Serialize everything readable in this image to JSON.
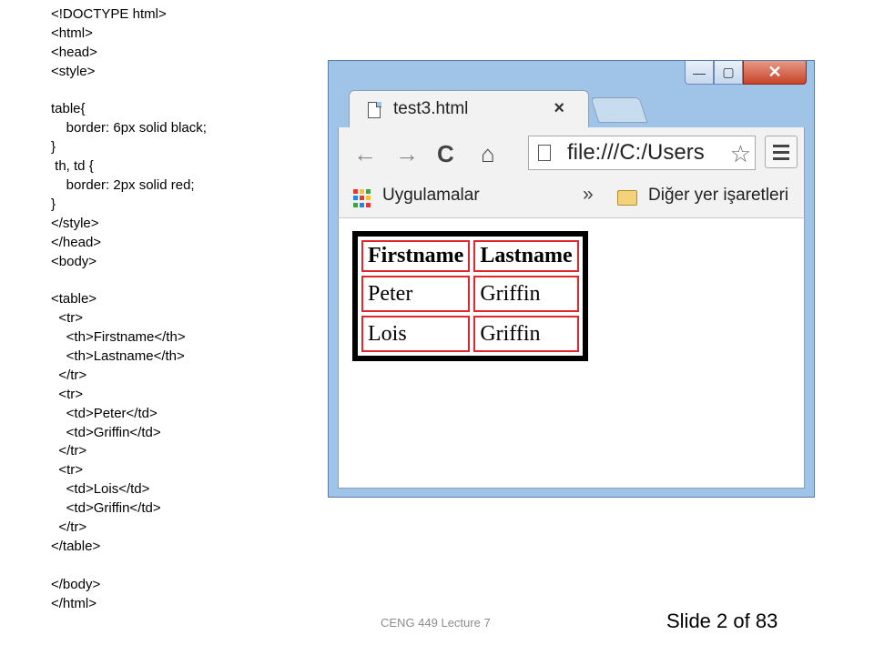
{
  "code_lines": [
    "<!DOCTYPE html>",
    "<html>",
    "<head>",
    "<style>",
    "",
    "table{",
    "    border: 6px solid black;",
    "}",
    " th, td {",
    "    border: 2px solid red;",
    "}",
    "</style>",
    "</head>",
    "<body>",
    "",
    "<table>",
    "  <tr>",
    "    <th>Firstname</th>",
    "    <th>Lastname</th>",
    "  </tr>",
    "  <tr>",
    "    <td>Peter</td>",
    "    <td>Griffin</td>",
    "  </tr>",
    "  <tr>",
    "    <td>Lois</td>",
    "    <td>Griffin</td>",
    "  </tr>",
    "</table>",
    "",
    "</body>",
    "</html>"
  ],
  "browser": {
    "tab_title": "test3.html",
    "tab_close": "×",
    "url": "file:///C:/Users",
    "nav": {
      "back": "←",
      "forward": "→",
      "reload": "C",
      "home": "⌂",
      "star": "☆"
    },
    "window_controls": {
      "minimize": "—",
      "maximize": "▢",
      "close": "✕"
    },
    "bookmarks": {
      "apps": "Uygulamalar",
      "more": "»",
      "other": "Diğer yer işaretleri"
    },
    "app_colors": [
      "#e53935",
      "#fbc02d",
      "#43a047",
      "#1e88e5",
      "#e53935",
      "#fbc02d",
      "#43a047",
      "#1e88e5",
      "#e53935"
    ]
  },
  "demo_table": {
    "headers": [
      "Firstname",
      "Lastname"
    ],
    "rows": [
      [
        "Peter",
        "Griffin"
      ],
      [
        "Lois",
        "Griffin"
      ]
    ],
    "outer_border_color": "#000000",
    "cell_border_color": "#e3262b"
  },
  "footer": {
    "lecture": "CENG 449 Lecture 7",
    "slide": "Slide 2 of 83"
  }
}
